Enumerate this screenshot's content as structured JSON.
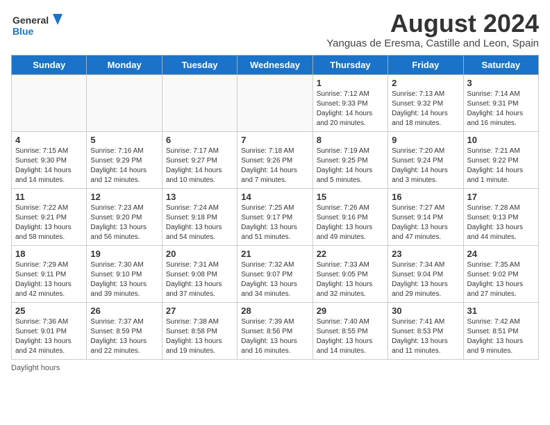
{
  "logo": {
    "line1": "General",
    "line2": "Blue"
  },
  "title": "August 2024",
  "location": "Yanguas de Eresma, Castille and Leon, Spain",
  "days_of_week": [
    "Sunday",
    "Monday",
    "Tuesday",
    "Wednesday",
    "Thursday",
    "Friday",
    "Saturday"
  ],
  "weeks": [
    [
      {
        "day": "",
        "info": ""
      },
      {
        "day": "",
        "info": ""
      },
      {
        "day": "",
        "info": ""
      },
      {
        "day": "",
        "info": ""
      },
      {
        "day": "1",
        "info": "Sunrise: 7:12 AM\nSunset: 9:33 PM\nDaylight: 14 hours and 20 minutes."
      },
      {
        "day": "2",
        "info": "Sunrise: 7:13 AM\nSunset: 9:32 PM\nDaylight: 14 hours and 18 minutes."
      },
      {
        "day": "3",
        "info": "Sunrise: 7:14 AM\nSunset: 9:31 PM\nDaylight: 14 hours and 16 minutes."
      }
    ],
    [
      {
        "day": "4",
        "info": "Sunrise: 7:15 AM\nSunset: 9:30 PM\nDaylight: 14 hours and 14 minutes."
      },
      {
        "day": "5",
        "info": "Sunrise: 7:16 AM\nSunset: 9:29 PM\nDaylight: 14 hours and 12 minutes."
      },
      {
        "day": "6",
        "info": "Sunrise: 7:17 AM\nSunset: 9:27 PM\nDaylight: 14 hours and 10 minutes."
      },
      {
        "day": "7",
        "info": "Sunrise: 7:18 AM\nSunset: 9:26 PM\nDaylight: 14 hours and 7 minutes."
      },
      {
        "day": "8",
        "info": "Sunrise: 7:19 AM\nSunset: 9:25 PM\nDaylight: 14 hours and 5 minutes."
      },
      {
        "day": "9",
        "info": "Sunrise: 7:20 AM\nSunset: 9:24 PM\nDaylight: 14 hours and 3 minutes."
      },
      {
        "day": "10",
        "info": "Sunrise: 7:21 AM\nSunset: 9:22 PM\nDaylight: 14 hours and 1 minute."
      }
    ],
    [
      {
        "day": "11",
        "info": "Sunrise: 7:22 AM\nSunset: 9:21 PM\nDaylight: 13 hours and 58 minutes."
      },
      {
        "day": "12",
        "info": "Sunrise: 7:23 AM\nSunset: 9:20 PM\nDaylight: 13 hours and 56 minutes."
      },
      {
        "day": "13",
        "info": "Sunrise: 7:24 AM\nSunset: 9:18 PM\nDaylight: 13 hours and 54 minutes."
      },
      {
        "day": "14",
        "info": "Sunrise: 7:25 AM\nSunset: 9:17 PM\nDaylight: 13 hours and 51 minutes."
      },
      {
        "day": "15",
        "info": "Sunrise: 7:26 AM\nSunset: 9:16 PM\nDaylight: 13 hours and 49 minutes."
      },
      {
        "day": "16",
        "info": "Sunrise: 7:27 AM\nSunset: 9:14 PM\nDaylight: 13 hours and 47 minutes."
      },
      {
        "day": "17",
        "info": "Sunrise: 7:28 AM\nSunset: 9:13 PM\nDaylight: 13 hours and 44 minutes."
      }
    ],
    [
      {
        "day": "18",
        "info": "Sunrise: 7:29 AM\nSunset: 9:11 PM\nDaylight: 13 hours and 42 minutes."
      },
      {
        "day": "19",
        "info": "Sunrise: 7:30 AM\nSunset: 9:10 PM\nDaylight: 13 hours and 39 minutes."
      },
      {
        "day": "20",
        "info": "Sunrise: 7:31 AM\nSunset: 9:08 PM\nDaylight: 13 hours and 37 minutes."
      },
      {
        "day": "21",
        "info": "Sunrise: 7:32 AM\nSunset: 9:07 PM\nDaylight: 13 hours and 34 minutes."
      },
      {
        "day": "22",
        "info": "Sunrise: 7:33 AM\nSunset: 9:05 PM\nDaylight: 13 hours and 32 minutes."
      },
      {
        "day": "23",
        "info": "Sunrise: 7:34 AM\nSunset: 9:04 PM\nDaylight: 13 hours and 29 minutes."
      },
      {
        "day": "24",
        "info": "Sunrise: 7:35 AM\nSunset: 9:02 PM\nDaylight: 13 hours and 27 minutes."
      }
    ],
    [
      {
        "day": "25",
        "info": "Sunrise: 7:36 AM\nSunset: 9:01 PM\nDaylight: 13 hours and 24 minutes."
      },
      {
        "day": "26",
        "info": "Sunrise: 7:37 AM\nSunset: 8:59 PM\nDaylight: 13 hours and 22 minutes."
      },
      {
        "day": "27",
        "info": "Sunrise: 7:38 AM\nSunset: 8:58 PM\nDaylight: 13 hours and 19 minutes."
      },
      {
        "day": "28",
        "info": "Sunrise: 7:39 AM\nSunset: 8:56 PM\nDaylight: 13 hours and 16 minutes."
      },
      {
        "day": "29",
        "info": "Sunrise: 7:40 AM\nSunset: 8:55 PM\nDaylight: 13 hours and 14 minutes."
      },
      {
        "day": "30",
        "info": "Sunrise: 7:41 AM\nSunset: 8:53 PM\nDaylight: 13 hours and 11 minutes."
      },
      {
        "day": "31",
        "info": "Sunrise: 7:42 AM\nSunset: 8:51 PM\nDaylight: 13 hours and 9 minutes."
      }
    ]
  ],
  "footer": "Daylight hours"
}
